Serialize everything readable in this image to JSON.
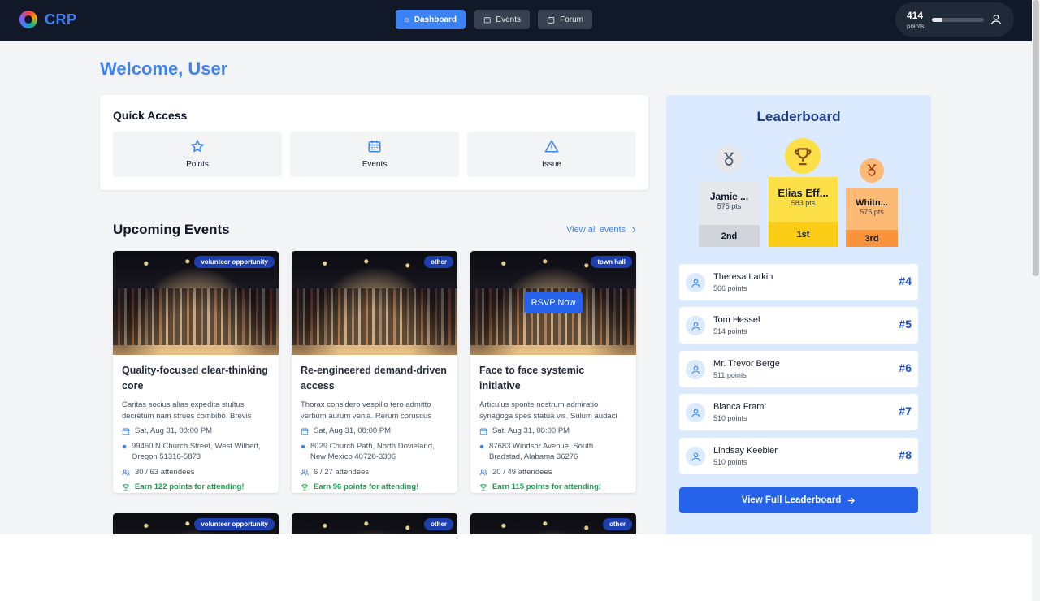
{
  "app": {
    "logo_text": "CRP"
  },
  "nav": {
    "dashboard": "Dashboard",
    "events": "Events",
    "forum": "Forum"
  },
  "user_points": {
    "value": "414",
    "label": "points",
    "progress": 0.2
  },
  "welcome": "Welcome, User",
  "quick_access": {
    "title": "Quick Access",
    "items": [
      {
        "label": "Points",
        "icon": "star-icon"
      },
      {
        "label": "Events",
        "icon": "calendar-icon"
      },
      {
        "label": "Issue",
        "icon": "warning-icon"
      }
    ]
  },
  "upcoming": {
    "title": "Upcoming Events",
    "view_all": "View all events",
    "events": [
      {
        "badge": "volunteer opportunity",
        "title": "Quality-focused clear-thinking core",
        "desc": "Caritas socius alias expedita stultus decretum nam strues combibo. Brevis",
        "date": "Sat, Aug 31, 08:00 PM",
        "address": "99460 N Church Street, West Wilbert, Oregon 51316-5873",
        "attendees": "30 / 63 attendees",
        "earn": "Earn 122 points for attending!"
      },
      {
        "badge": "other",
        "title": "Re-engineered demand-driven access",
        "desc": "Thorax considero vespillo tero admitto verbum aurum venia. Rerum coruscus",
        "date": "Sat, Aug 31, 08:00 PM",
        "address": "8029 Church Path, North Dovieland, New Mexico 40728-3306",
        "attendees": "6 / 27 attendees",
        "earn": "Earn 96 points for attending!"
      },
      {
        "badge": "town hall",
        "rsvp": "RSVP Now",
        "title": "Face to face systemic initiative",
        "desc": "Articulus sponte nostrum admiratio synagoga spes statua vis. Sulum audaci",
        "date": "Sat, Aug 31, 08:00 PM",
        "address": "87683 Windsor Avenue, South Bradstad, Alabama 36276",
        "attendees": "20 / 49 attendees",
        "earn": "Earn 115 points for attending!"
      },
      {
        "badge": "volunteer opportunity"
      },
      {
        "badge": "other"
      },
      {
        "badge": "other"
      }
    ]
  },
  "leaderboard": {
    "title": "Leaderboard",
    "podium": [
      {
        "name": "Jamie ...",
        "pts": "575 pts",
        "rank": "2nd"
      },
      {
        "name": "Elias Eff...",
        "pts": "583 pts",
        "rank": "1st"
      },
      {
        "name": "Whitn...",
        "pts": "575 pts",
        "rank": "3rd"
      }
    ],
    "rows": [
      {
        "name": "Theresa Larkin",
        "pts": "566 points",
        "rank": "#4"
      },
      {
        "name": "Tom Hessel",
        "pts": "514 points",
        "rank": "#5"
      },
      {
        "name": "Mr. Trevor Berge",
        "pts": "511 points",
        "rank": "#6"
      },
      {
        "name": "Blanca Frami",
        "pts": "510 points",
        "rank": "#7"
      },
      {
        "name": "Lindsay Keebler",
        "pts": "510 points",
        "rank": "#8"
      }
    ],
    "view_full": "View Full Leaderboard"
  },
  "colors": {
    "accent": "#3b82f6",
    "nav_bg": "#111827",
    "gold": "#fde047",
    "bronze": "#fdba74",
    "earn": "#16a34a"
  }
}
